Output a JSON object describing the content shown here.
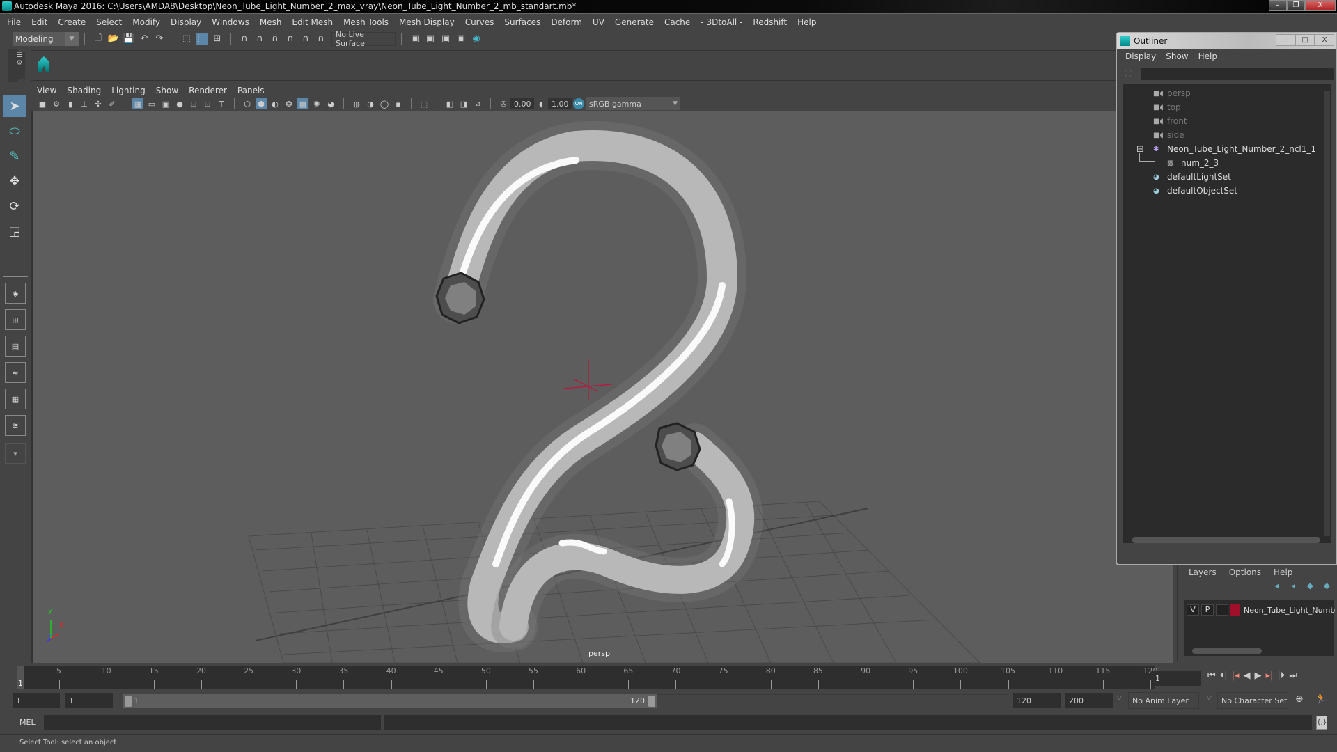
{
  "window": {
    "title": "Autodesk Maya 2016: C:\\Users\\AMDA8\\Desktop\\Neon_Tube_Light_Number_2_max_vray\\Neon_Tube_Light_Number_2_mb_standart.mb*",
    "minimize": "–",
    "restore": "❐",
    "close": "X"
  },
  "menubar": [
    "File",
    "Edit",
    "Create",
    "Select",
    "Modify",
    "Display",
    "Windows",
    "Mesh",
    "Edit Mesh",
    "Mesh Tools",
    "Mesh Display",
    "Curves",
    "Surfaces",
    "Deform",
    "UV",
    "Generate",
    "Cache",
    "- 3DtoAll -",
    "Redshift",
    "Help"
  ],
  "statusline": {
    "workspace": "Modeling",
    "live_surface": "No Live Surface"
  },
  "panel": {
    "menus": [
      "View",
      "Shading",
      "Lighting",
      "Show",
      "Renderer",
      "Panels"
    ],
    "exposure": "0.00",
    "gamma": "1.00",
    "color_space": "sRGB gamma",
    "camera_label": "persp",
    "axis": {
      "x": "x",
      "y": "y",
      "z": "z"
    }
  },
  "outliner": {
    "title": "Outliner",
    "menus": [
      "Display",
      "Show",
      "Help"
    ],
    "search_value": "",
    "items": [
      {
        "label": "persp",
        "icon": "camera-icon",
        "dim": true,
        "indent": 0
      },
      {
        "label": "top",
        "icon": "camera-icon",
        "dim": true,
        "indent": 0
      },
      {
        "label": "front",
        "icon": "camera-icon",
        "dim": true,
        "indent": 0
      },
      {
        "label": "side",
        "icon": "camera-icon",
        "dim": true,
        "indent": 0
      },
      {
        "label": "Neon_Tube_Light_Number_2_ncl1_1",
        "icon": "nucleus-icon",
        "dim": false,
        "indent": 0,
        "expanded": true
      },
      {
        "label": "num_2_3",
        "icon": "mesh-icon",
        "dim": false,
        "indent": 1
      },
      {
        "label": "defaultLightSet",
        "icon": "set-icon",
        "dim": false,
        "indent": 0
      },
      {
        "label": "defaultObjectSet",
        "icon": "set-icon",
        "dim": false,
        "indent": 0
      }
    ]
  },
  "layers": {
    "menus": [
      "Layers",
      "Options",
      "Help"
    ],
    "rows": [
      {
        "visible": "V",
        "playback": "P",
        "color": "#a0102a",
        "name": "Neon_Tube_Light_Numb"
      }
    ]
  },
  "timeline": {
    "ticks": [
      5,
      10,
      15,
      20,
      25,
      30,
      35,
      40,
      45,
      50,
      55,
      60,
      65,
      70,
      75,
      80,
      85,
      90,
      95,
      100,
      105,
      110,
      115,
      120
    ],
    "start": 1,
    "end": 120,
    "current_frame_label": "1",
    "current_frame": "1"
  },
  "range": {
    "start_time": "1",
    "playback_start": "1",
    "slider_start": "1",
    "slider_end": "120",
    "playback_end": "120",
    "end_time": "200",
    "anim_layer": "No Anim Layer",
    "character_set": "No Character Set"
  },
  "cmdline": {
    "label": "MEL",
    "input": "",
    "output": ""
  },
  "helpline": "Select Tool: select an object",
  "colors": {
    "accent": "#5b86a8",
    "layer": "#a0102a",
    "crosshair": "#c0143c"
  }
}
